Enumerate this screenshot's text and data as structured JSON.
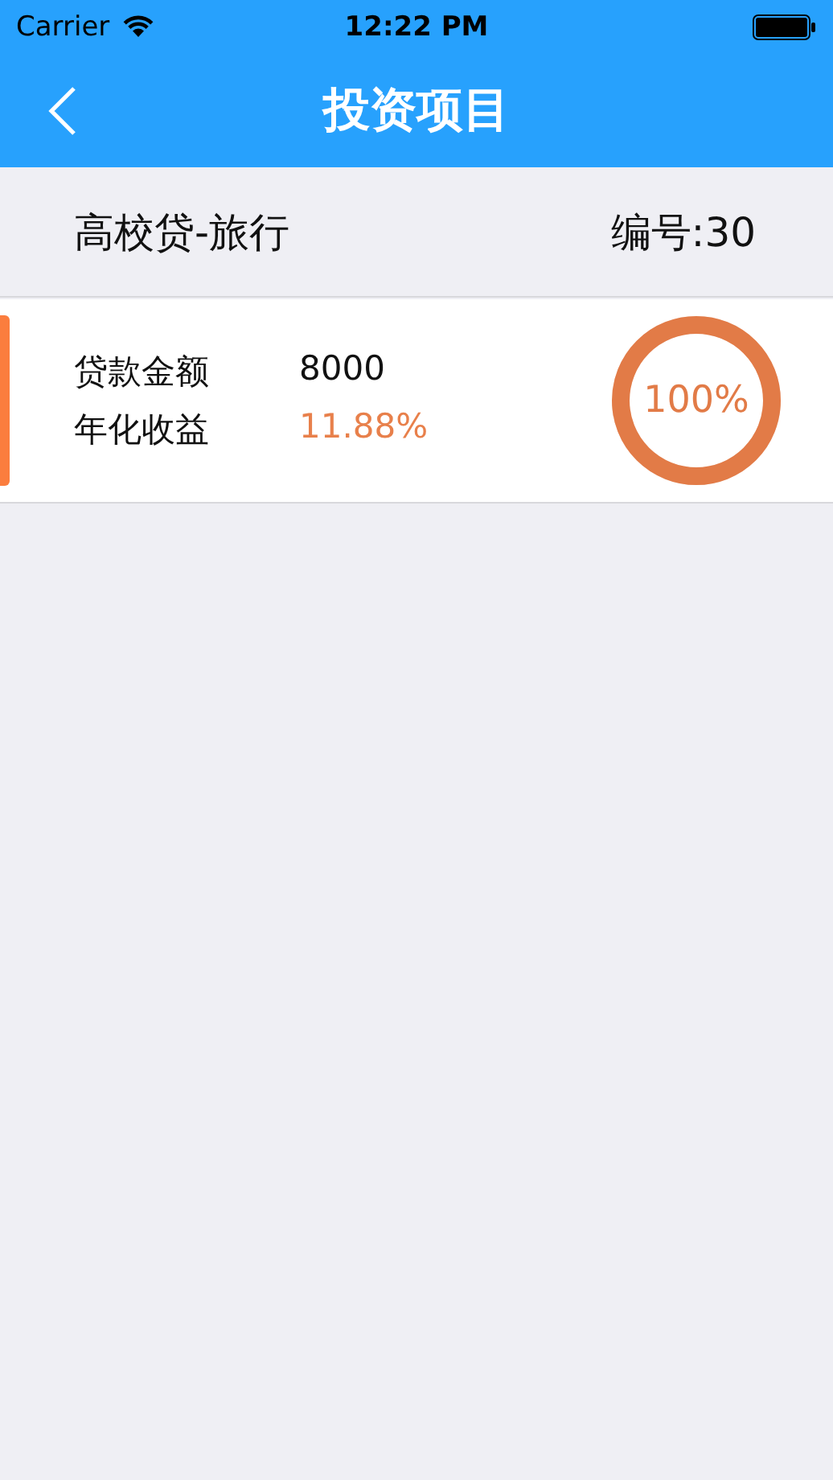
{
  "status_bar": {
    "carrier": "Carrier",
    "time": "12:22 PM"
  },
  "nav_bar": {
    "title": "投资项目"
  },
  "project": {
    "name": "高校贷-旅行",
    "number": "编号:30"
  },
  "card": {
    "rows": [
      {
        "label": "贷款金额",
        "value": "8000",
        "highlight": false
      },
      {
        "label": "年化收益",
        "value": "11.88%",
        "highlight": true
      }
    ],
    "progress": {
      "level": 1,
      "reading": "100%"
    }
  }
}
